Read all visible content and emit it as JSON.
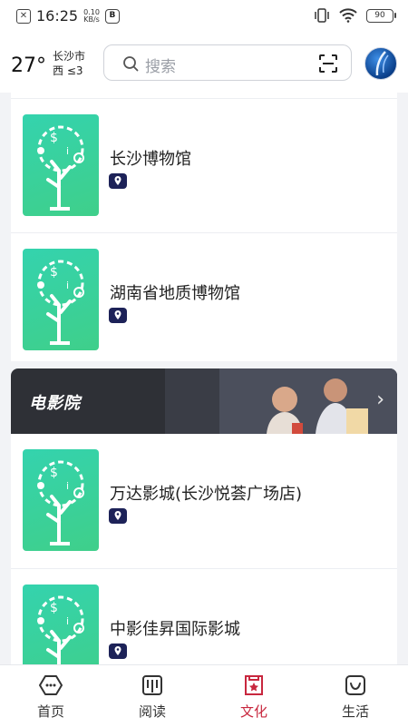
{
  "status_bar": {
    "time": "16:25",
    "speed_value": "0.10",
    "speed_unit": "KB/s",
    "battery": "90",
    "icons": [
      "notification-icon",
      "b-app-icon",
      "vibrate-icon",
      "wifi-icon",
      "battery-icon"
    ]
  },
  "header": {
    "temperature": "27°",
    "city": "长沙市",
    "wind": "西 ≤3",
    "search_placeholder": "搜索"
  },
  "list_top": [
    {
      "name": "长沙博物馆"
    },
    {
      "name": "湖南省地质博物馆"
    }
  ],
  "banner": {
    "title": "电影院"
  },
  "list_bottom": [
    {
      "name": "万达影城(长沙悦荟广场店)"
    },
    {
      "name": "中影佳昇国际影城"
    }
  ],
  "tabs": [
    {
      "label": "首页",
      "active": false
    },
    {
      "label": "阅读",
      "active": false
    },
    {
      "label": "文化",
      "active": true
    },
    {
      "label": "生活",
      "active": false
    }
  ],
  "colors": {
    "accent": "#c8273e",
    "thumb_green": "#3fcf8a",
    "pin_navy": "#1d2258",
    "banner_dark": "#2e3036"
  }
}
